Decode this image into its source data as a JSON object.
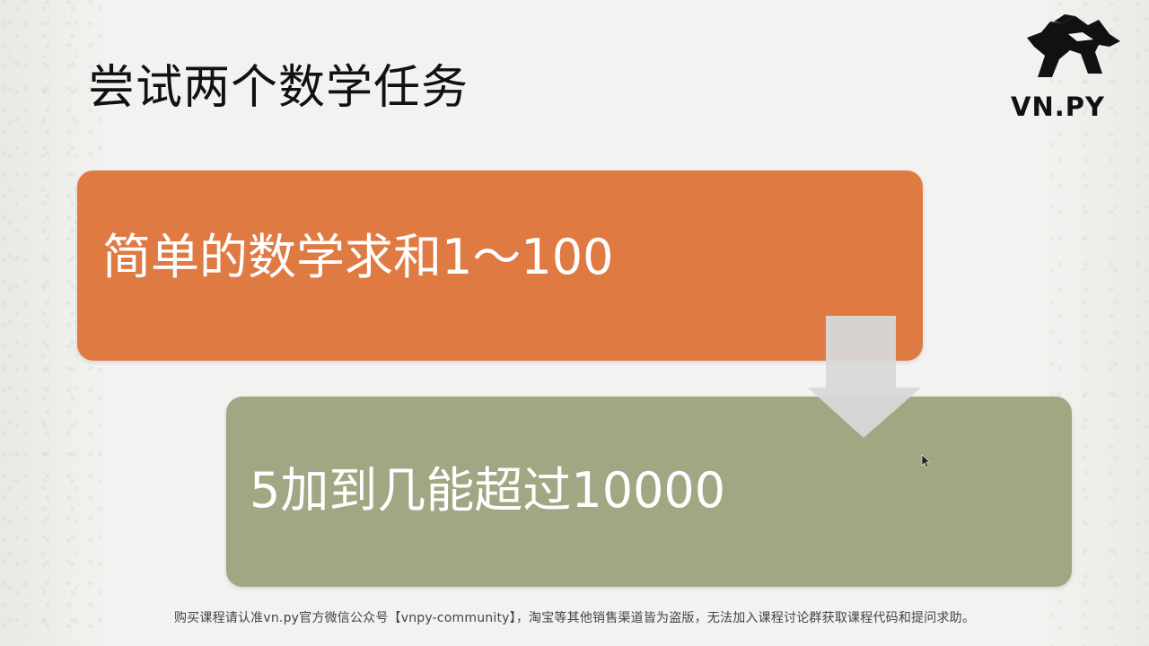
{
  "slide": {
    "title": "尝试两个数学任务",
    "logo_text": "VN.PY",
    "box1_text": "简单的数学求和1～100",
    "box2_text": "5加到几能超过10000",
    "footer_text": "购买课程请认准vn.py官方微信公众号【vnpy-community】，淘宝等其他销售渠道皆为盗版，无法加入课程讨论群获取课程代码和提问求助。",
    "icons": [
      "horse-logo-icon",
      "down-arrow-icon",
      "mouse-cursor-icon"
    ],
    "colors": {
      "background": "#f2f2f0",
      "title": "#111111",
      "box1": "#e07a43",
      "box2": "#a2a682",
      "box_text": "#ffffff",
      "arrow": "#d8d8d8",
      "footer": "#444444"
    }
  }
}
